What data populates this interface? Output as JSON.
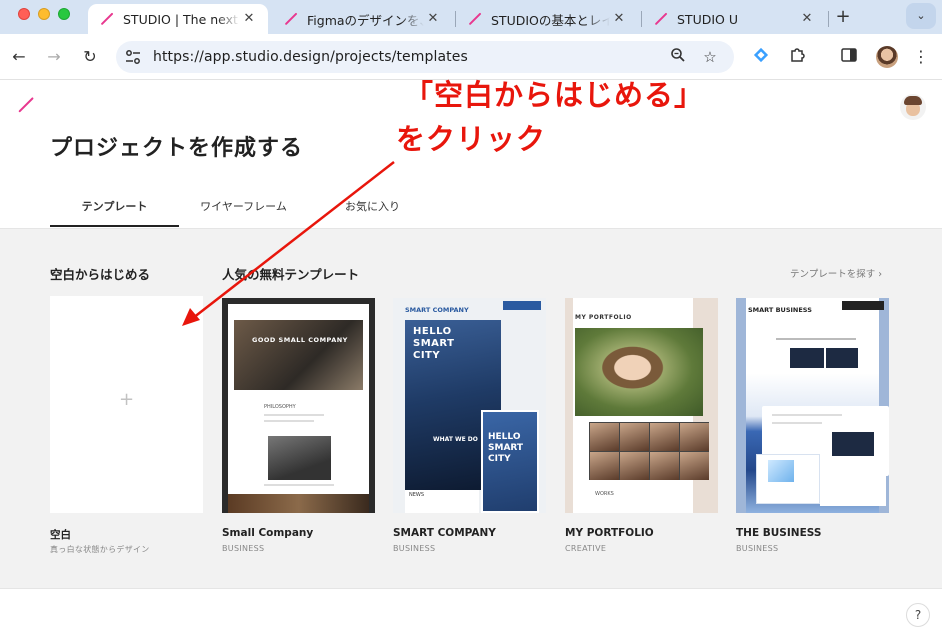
{
  "browser": {
    "tabs": [
      {
        "title": "STUDIO | The next g",
        "active": true
      },
      {
        "title": "Figmaのデザインを、",
        "active": false
      },
      {
        "title": "STUDIOの基本とレイ",
        "active": false
      },
      {
        "title": "STUDIO U",
        "active": false
      }
    ],
    "url": "https://app.studio.design/projects/templates",
    "icons": {
      "back": "back-arrow-icon",
      "forward": "forward-arrow-icon",
      "reload": "reload-icon",
      "zoom": "zoom-icon",
      "bookmark": "star-icon",
      "extension": "puzzle-icon",
      "sidepanel": "side-panel-icon",
      "menu": "kebab-menu-icon"
    }
  },
  "page": {
    "title": "プロジェクトを作成する",
    "tabs": [
      "テンプレート",
      "ワイヤーフレーム",
      "お気に入り"
    ],
    "blank_section_title": "空白からはじめる",
    "templates_section_title": "人気の無料テンプレート",
    "browse_link": "テンプレートを探す ›",
    "blank_card": {
      "plus": "+",
      "name": "空白",
      "description": "真っ白な状態からデザイン"
    },
    "templates": [
      {
        "name": "Small Company",
        "category": "BUSINESS",
        "thumb_texts": {
          "hero": "GOOD SMALL COMPANY",
          "section": "PHILOSOPHY"
        }
      },
      {
        "name": "SMART COMPANY",
        "category": "BUSINESS",
        "thumb_texts": {
          "brand": "SMART COMPANY",
          "hero": "HELLO SMART CITY",
          "what": "WHAT WE DO",
          "side": "HELLO SMART CITY",
          "news": "NEWS"
        }
      },
      {
        "name": "MY PORTFOLIO",
        "category": "CREATIVE",
        "thumb_texts": {
          "label": "MY PORTFOLIO",
          "foot": "WORKS"
        }
      },
      {
        "name": "THE BUSINESS",
        "category": "BUSINESS",
        "thumb_texts": {
          "brand": "SMART BUSINESS"
        }
      }
    ],
    "help": "?"
  },
  "annotation": {
    "line1": "「空白からはじめる」",
    "line2": "をクリック",
    "color": "#e8160c"
  },
  "colors": {
    "studio_pink": "#e8388f",
    "tabbar": "#d6e3f3",
    "gallery_bg": "#f2f2f2"
  }
}
